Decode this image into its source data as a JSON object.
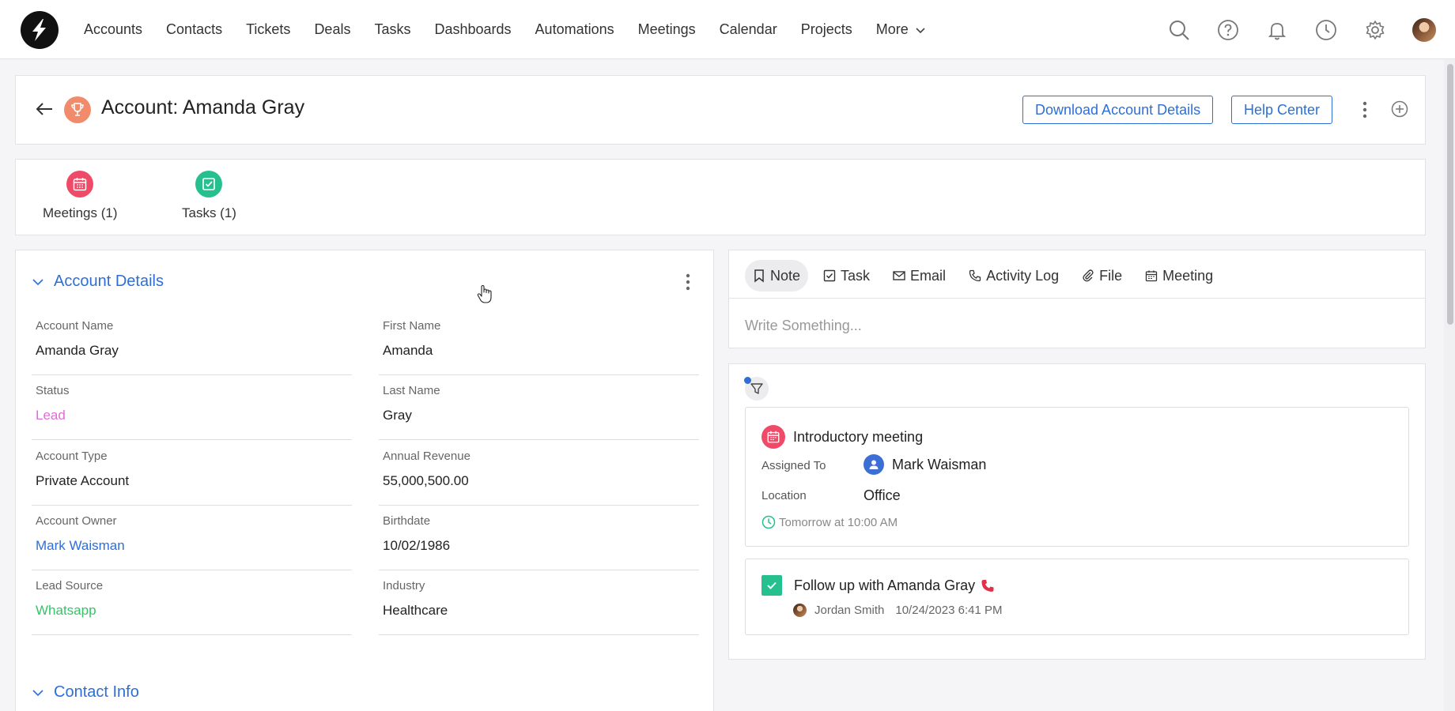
{
  "nav": {
    "items": [
      {
        "id": "accounts",
        "label": "Accounts"
      },
      {
        "id": "contacts",
        "label": "Contacts"
      },
      {
        "id": "tickets",
        "label": "Tickets"
      },
      {
        "id": "deals",
        "label": "Deals"
      },
      {
        "id": "tasks",
        "label": "Tasks"
      },
      {
        "id": "dashboards",
        "label": "Dashboards"
      },
      {
        "id": "automations",
        "label": "Automations"
      },
      {
        "id": "meetings",
        "label": "Meetings"
      },
      {
        "id": "calendar",
        "label": "Calendar"
      },
      {
        "id": "projects",
        "label": "Projects"
      }
    ],
    "more_label": "More",
    "right_icons": [
      "search-icon",
      "help-circle-icon",
      "bell-icon",
      "clock-icon",
      "gear-icon",
      "avatar"
    ]
  },
  "header": {
    "title": "Account: Amanda Gray",
    "download_label": "Download Account Details",
    "help_label": "Help Center",
    "icon": "trophy-icon"
  },
  "related": [
    {
      "id": "meetings",
      "label": "Meetings (1)",
      "icon": "calendar-icon",
      "color": "#ef4a68"
    },
    {
      "id": "tasks",
      "label": "Tasks (1)",
      "icon": "checkbox-icon",
      "color": "#25c08e"
    }
  ],
  "details": {
    "section_title": "Account Details",
    "contact_section_title": "Contact Info",
    "fields": {
      "account_name": {
        "label": "Account Name",
        "value": "Amanda Gray"
      },
      "first_name": {
        "label": "First Name",
        "value": "Amanda"
      },
      "status": {
        "label": "Status",
        "value": "Lead"
      },
      "last_name": {
        "label": "Last Name",
        "value": "Gray"
      },
      "account_type": {
        "label": "Account Type",
        "value": "Private Account"
      },
      "annual_revenue": {
        "label": "Annual Revenue",
        "value": "55,000,500.00"
      },
      "account_owner": {
        "label": "Account Owner",
        "value": "Mark Waisman"
      },
      "birthdate": {
        "label": "Birthdate",
        "value": "10/02/1986"
      },
      "lead_source": {
        "label": "Lead Source",
        "value": "Whatsapp"
      },
      "industry": {
        "label": "Industry",
        "value": "Healthcare"
      }
    }
  },
  "composer": {
    "tabs": [
      {
        "id": "note",
        "label": "Note",
        "icon": "bookmark-icon",
        "active": true
      },
      {
        "id": "task",
        "label": "Task",
        "icon": "checkbox-icon"
      },
      {
        "id": "email",
        "label": "Email",
        "icon": "mail-icon"
      },
      {
        "id": "activity_log",
        "label": "Activity Log",
        "icon": "phone-icon"
      },
      {
        "id": "file",
        "label": "File",
        "icon": "paperclip-icon"
      },
      {
        "id": "meeting",
        "label": "Meeting",
        "icon": "calendar-icon"
      }
    ],
    "placeholder": "Write Something..."
  },
  "timeline": {
    "meeting": {
      "title": "Introductory meeting",
      "assigned_label": "Assigned To",
      "assigned_value": "Mark Waisman",
      "location_label": "Location",
      "location_value": "Office",
      "time": "Tomorrow at 10:00 AM"
    },
    "task": {
      "title": "Follow up with Amanda Gray",
      "user": "Jordan Smith",
      "date": "10/24/2023 6:41 PM"
    }
  },
  "colors": {
    "accent": "#2d6fd6",
    "status_lead": "#e06cd8",
    "lead_source_whatsapp": "#37c26a",
    "meeting": "#ef4a68",
    "task": "#25c08e"
  }
}
